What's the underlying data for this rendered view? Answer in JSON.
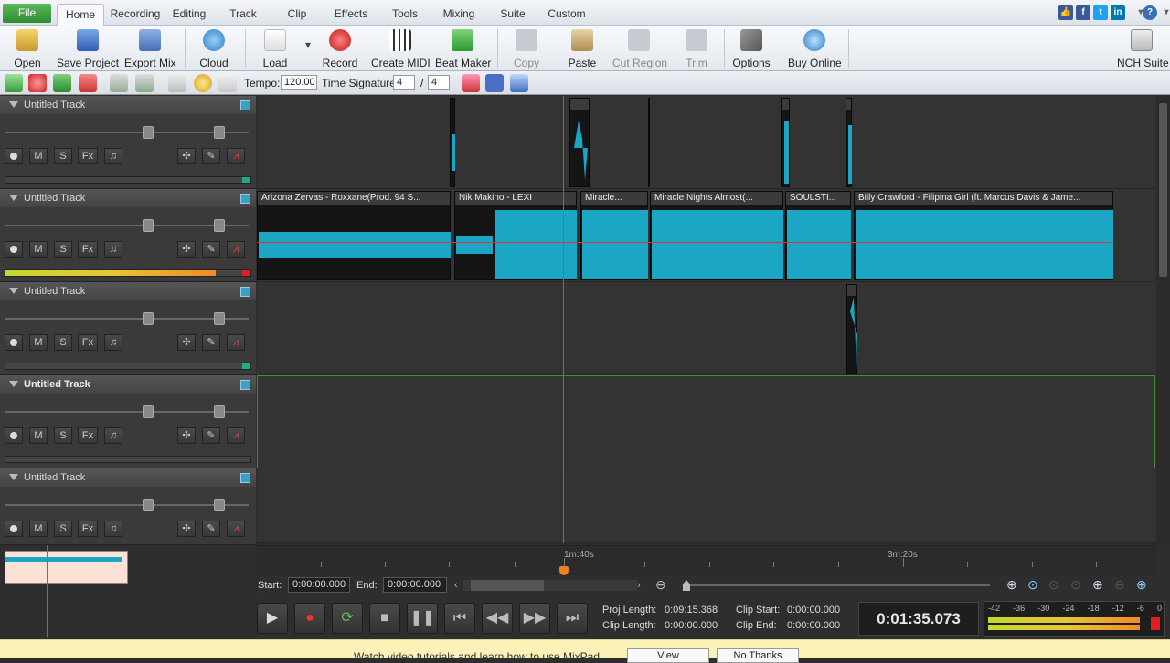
{
  "menu": {
    "file": "File",
    "tabs": [
      "Home",
      "Recording",
      "Editing",
      "Track",
      "Clip",
      "Effects",
      "Tools",
      "Mixing",
      "Suite",
      "Custom"
    ],
    "active_tab": "Home"
  },
  "ribbon": {
    "open": "Open",
    "save_project": "Save Project",
    "export_mix": "Export Mix",
    "cloud": "Cloud",
    "load": "Load",
    "record": "Record",
    "create_midi": "Create MIDI",
    "beat_maker": "Beat Maker",
    "copy": "Copy",
    "paste": "Paste",
    "cut_region": "Cut Region",
    "trim": "Trim",
    "options": "Options",
    "buy_online": "Buy Online",
    "nch_suite": "NCH Suite"
  },
  "toolbar": {
    "tempo_label": "Tempo:",
    "tempo": "120.00",
    "timesig_label": "Time Signature:",
    "timesig_num": "4",
    "timesig_sep": "/",
    "timesig_den": "4"
  },
  "tracks": [
    {
      "name": "Untitled Track",
      "selected": false,
      "meter_level": 0.0
    },
    {
      "name": "Untitled Track",
      "selected": false,
      "meter_level": 0.86
    },
    {
      "name": "Untitled Track",
      "selected": false,
      "meter_level": 0.0
    },
    {
      "name": "Untitled Track",
      "selected": true,
      "meter_level": 0.0
    },
    {
      "name": "Untitled Track",
      "selected": false,
      "meter_level": 0.0
    }
  ],
  "track_buttons": {
    "mute": "M",
    "solo": "S",
    "fx": "Fx"
  },
  "clips_track2": [
    {
      "title": "Arizona Zervas - Roxxane(Prod. 94 S..."
    },
    {
      "title": "Nik Makino - LEXI"
    },
    {
      "title": "Miracle..."
    },
    {
      "title": "Miracle Nights Almost(..."
    },
    {
      "title": "SOULSTI..."
    },
    {
      "title": "Billy Crawford - Filipina Girl (ft. Marcus Davis & Jame..."
    }
  ],
  "ruler": {
    "label1": "1m:40s",
    "label2": "3m:20s"
  },
  "range": {
    "start_label": "Start:",
    "start": "0:00:00.000",
    "end_label": "End:",
    "end": "0:00:00.000"
  },
  "info": {
    "proj_length_label": "Proj Length:",
    "proj_length": "0:09:15.368",
    "clip_length_label": "Clip Length:",
    "clip_length": "0:00:00.000",
    "clip_start_label": "Clip Start:",
    "clip_start": "0:00:00.000",
    "clip_end_label": "Clip End:",
    "clip_end": "0:00:00.000"
  },
  "time_display": "0:01:35.073",
  "vu_scale": [
    "-42",
    "-36",
    "-30",
    "-24",
    "-18",
    "-12",
    "-6",
    "0"
  ],
  "notice": {
    "text": "Watch video tutorials and learn how to use MixPad",
    "view": "View",
    "no_thanks": "No Thanks"
  },
  "colors": {
    "waveform": "#1aa6c4",
    "playhead": "#e04040",
    "accent_green": "#3a9a3a"
  }
}
